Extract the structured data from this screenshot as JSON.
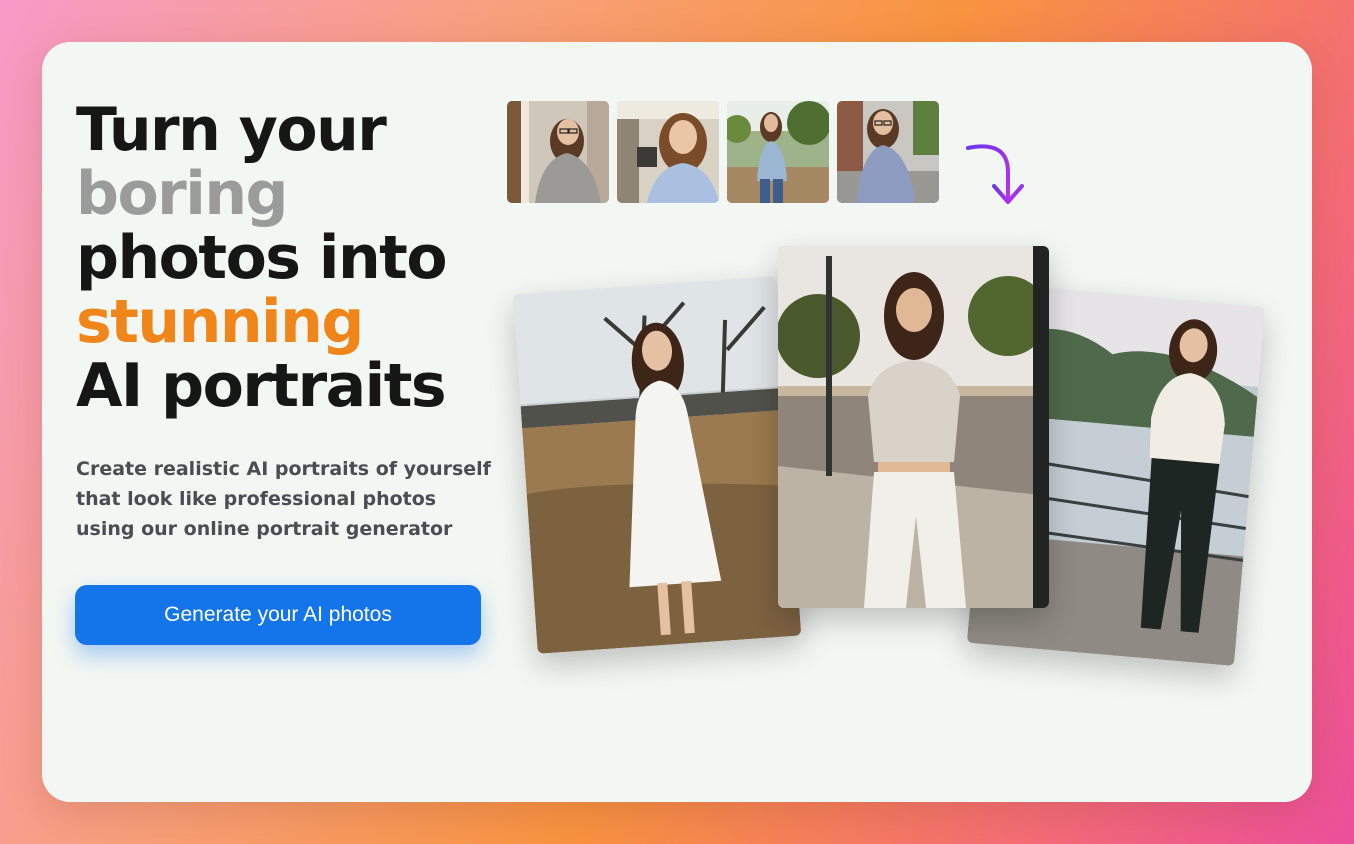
{
  "hero": {
    "headline": {
      "line1": "Turn your",
      "line2": "boring",
      "line3": "photos into",
      "line4": "stunning",
      "line5": "AI portraits"
    },
    "description": "Create realistic AI portraits of yourself that look like professional photos using our online portrait generator",
    "cta_label": "Generate your AI photos"
  },
  "input_photos": [
    {
      "icon": "portrait-photo-indoor-sweater"
    },
    {
      "icon": "portrait-photo-office-selfie"
    },
    {
      "icon": "portrait-photo-outdoor-street"
    },
    {
      "icon": "portrait-photo-sidewalk"
    }
  ],
  "generated_photos": [
    {
      "icon": "portrait-white-dress-field"
    },
    {
      "icon": "portrait-crop-top-street"
    },
    {
      "icon": "portrait-sweater-waterfront"
    }
  ],
  "colors": {
    "background_gradient": [
      "#f79ac8",
      "#f8943f",
      "#ec4f9b"
    ],
    "card_bg": "#f3f7f3",
    "headline_text": "#161616",
    "headline_muted": "#9b9b9b",
    "headline_accent": "#f08619",
    "cta_bg": "#1474ea",
    "arrow": "#a42df0"
  }
}
